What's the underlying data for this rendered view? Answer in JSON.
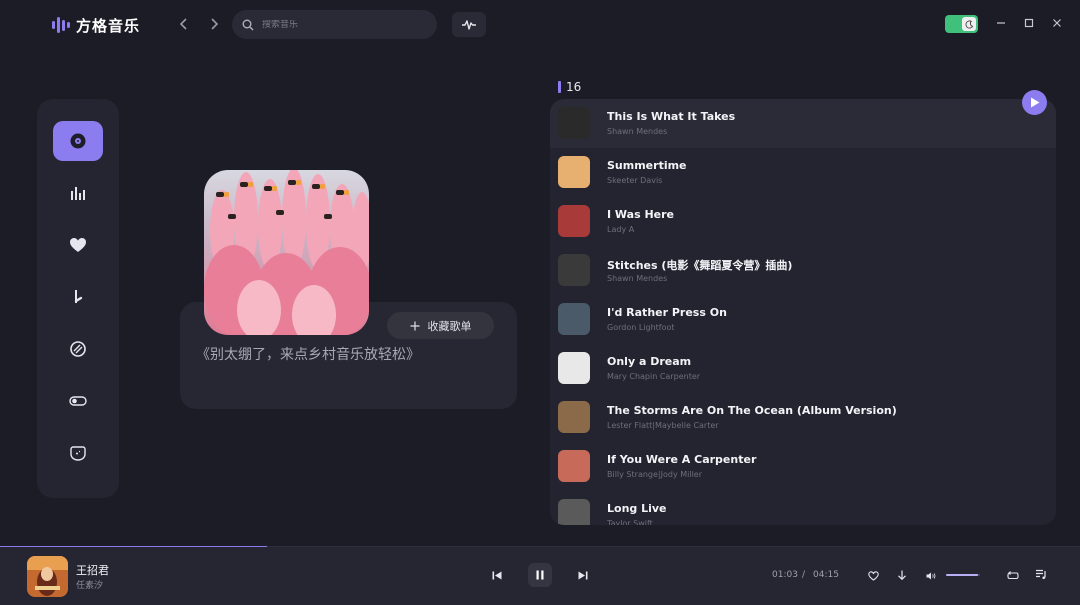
{
  "app": {
    "name": "方格音乐"
  },
  "search": {
    "placeholder": "搜索音乐"
  },
  "sidebar": {
    "items": [
      {
        "icon": "disc-icon",
        "active": true
      },
      {
        "icon": "chart-icon"
      },
      {
        "icon": "heart-icon"
      },
      {
        "icon": "music-note-icon"
      },
      {
        "icon": "vinyl-icon"
      },
      {
        "icon": "toggle-icon"
      },
      {
        "icon": "badge-icon"
      }
    ]
  },
  "playlist": {
    "description": "《别太绷了，来点乡村音乐放轻松》",
    "favorite_label": "收藏歌单",
    "count": "16"
  },
  "tracks": [
    {
      "title": "This Is What It Takes",
      "artist": "Shawn Mendes",
      "thumb_color": "#2a2a2a"
    },
    {
      "title": "Summertime",
      "artist": "Skeeter Davis",
      "thumb_color": "#e8b070"
    },
    {
      "title": "I Was Here",
      "artist": "Lady A",
      "thumb_color": "#a83a3a"
    },
    {
      "title": "Stitches (电影《舞蹈夏令营》插曲)",
      "artist": "Shawn Mendes",
      "thumb_color": "#3a3a3a"
    },
    {
      "title": "I'd Rather Press On",
      "artist": "Gordon Lightfoot",
      "thumb_color": "#4a5a68"
    },
    {
      "title": "Only a Dream",
      "artist": "Mary Chapin Carpenter",
      "thumb_color": "#e8e8e8"
    },
    {
      "title": "The Storms Are On The Ocean (Album Version)",
      "artist": "Lester Flatt|Maybelle Carter",
      "thumb_color": "#8a6a48"
    },
    {
      "title": "If You Were A Carpenter",
      "artist": "Billy Strange|Jody Miller",
      "thumb_color": "#c86a5a"
    },
    {
      "title": "Long Live",
      "artist": "Taylor Swift",
      "thumb_color": "#5a5a5a"
    }
  ],
  "now_playing": {
    "title": "王招君",
    "artist": "任素汐",
    "current_time": "01:03",
    "separator": "/",
    "total_time": "04:15",
    "progress": 0.247,
    "volume": 0.95
  },
  "colors": {
    "accent": "#8b7cf0",
    "toggle": "#3fc17c"
  }
}
